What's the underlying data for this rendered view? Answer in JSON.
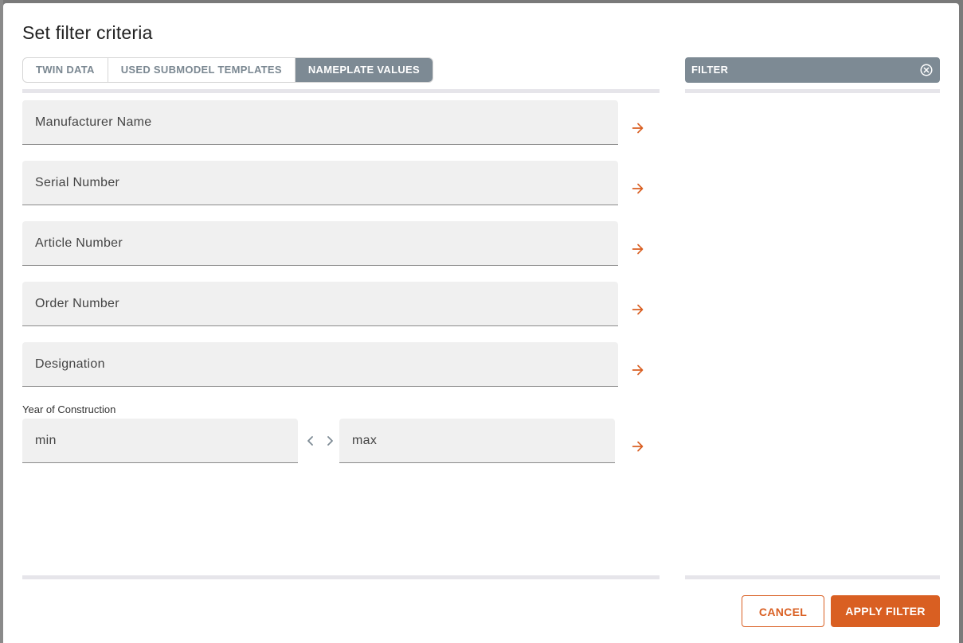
{
  "dialog": {
    "title": "Set filter criteria"
  },
  "tabs": [
    {
      "label": "TWIN DATA",
      "active": false
    },
    {
      "label": "USED SUBMODEL TEMPLATES",
      "active": false
    },
    {
      "label": "NAMEPLATE VALUES",
      "active": true
    }
  ],
  "fields": [
    {
      "placeholder": "Manufacturer Name",
      "value": ""
    },
    {
      "placeholder": "Serial Number",
      "value": ""
    },
    {
      "placeholder": "Article Number",
      "value": ""
    },
    {
      "placeholder": "Order Number",
      "value": ""
    },
    {
      "placeholder": "Designation",
      "value": ""
    }
  ],
  "year_of_construction": {
    "label": "Year of Construction",
    "min_placeholder": "min",
    "max_placeholder": "max"
  },
  "filter_panel": {
    "title": "FILTER"
  },
  "actions": {
    "cancel_label": "CANCEL",
    "apply_label": "APPLY FILTER"
  },
  "colors": {
    "accent": "#d95f22",
    "tab_active": "#7d8a94",
    "field_bg": "#f0f0f0",
    "divider": "#e6e5ea"
  },
  "icons": {
    "add_arrow": "arrow-right-icon",
    "clear": "close-circle-icon",
    "range_left": "chevron-left-icon",
    "range_right": "chevron-right-icon"
  }
}
